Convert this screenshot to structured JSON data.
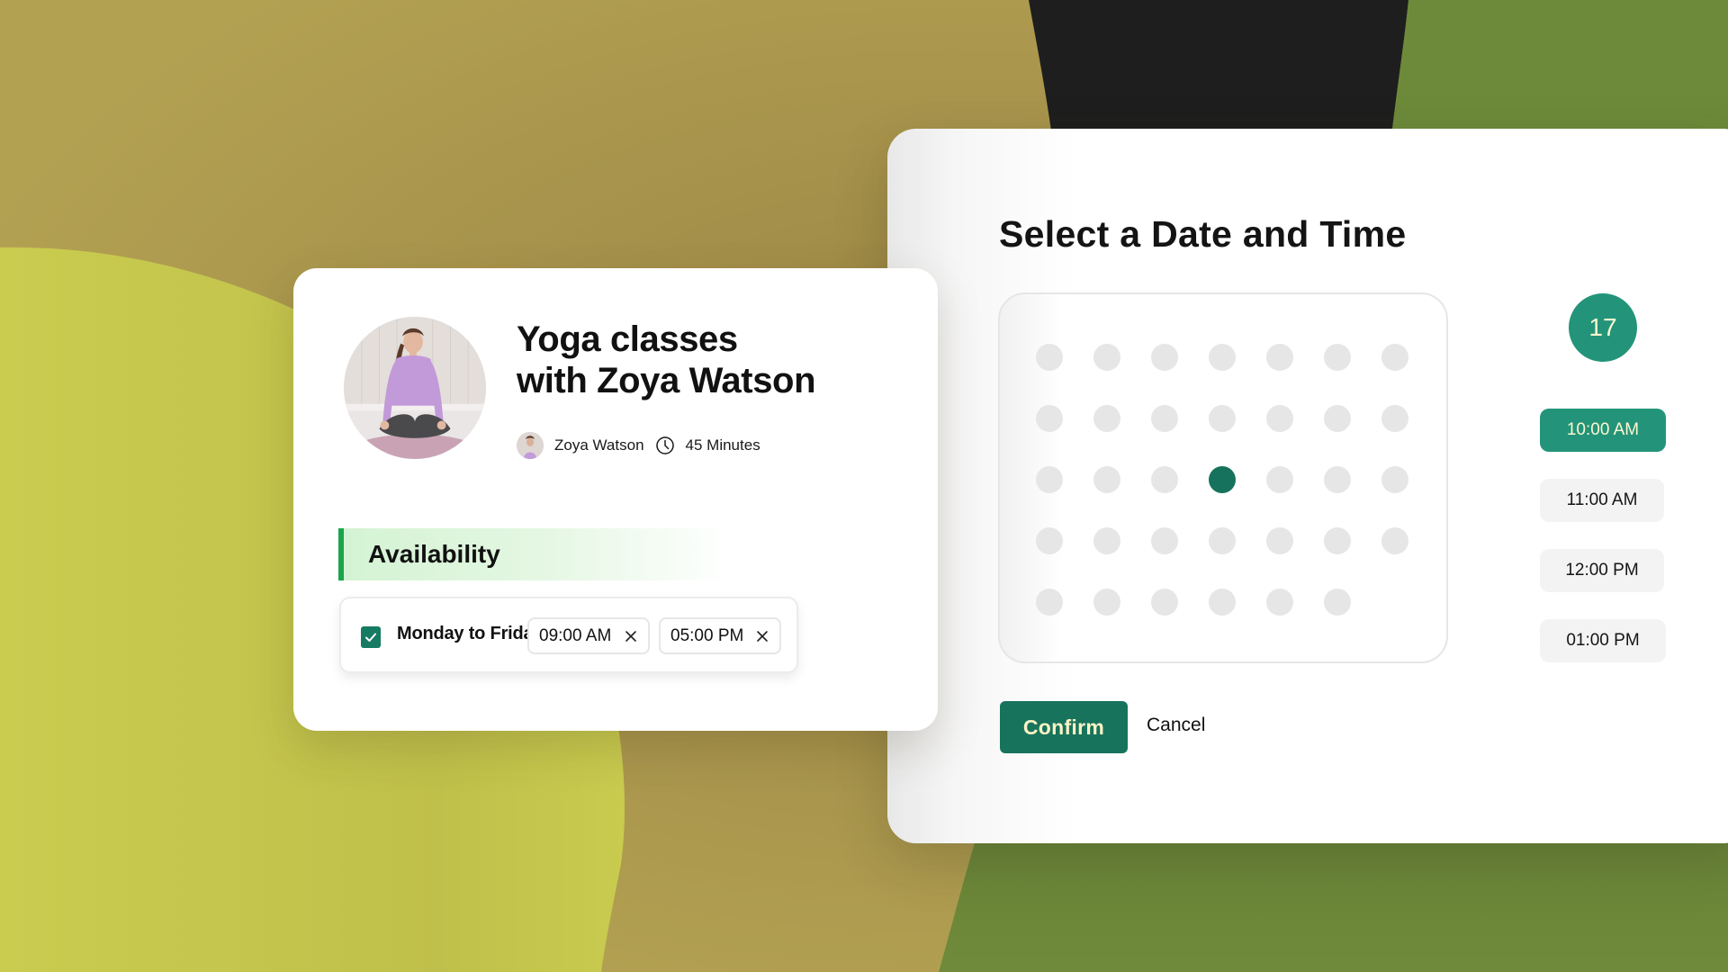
{
  "colors": {
    "background_olive": "#b09e50",
    "background_lime": "#c8cb4e",
    "background_dark": "#1e1e1e",
    "background_green": "#6d8a3a",
    "accent_green": "#23947a",
    "button_green": "#18735c",
    "availability_bar": "#1aa54a",
    "button_text": "#fbf3c6"
  },
  "class_card": {
    "photo": "yoga-instructor-photo",
    "title_line1": "Yoga classes",
    "title_line2": "with Zoya Watson",
    "instructor_name": "Zoya Watson",
    "duration": "45 Minutes",
    "availability": {
      "heading": "Availability",
      "days_label": "Monday to Friday",
      "days_checked": true,
      "start_time": "09:00 AM",
      "end_time": "05:00 PM"
    }
  },
  "date_picker": {
    "title": "Select a Date and Time",
    "calendar": {
      "rows": [
        7,
        7,
        7,
        7,
        6
      ],
      "selected_row": 3,
      "selected_col": 4
    },
    "selected_date": "17",
    "time_slots": [
      {
        "label": "10:00 AM",
        "selected": true
      },
      {
        "label": "11:00 AM",
        "selected": false
      },
      {
        "label": "12:00 PM",
        "selected": false
      },
      {
        "label": "01:00 PM",
        "selected": false
      }
    ],
    "confirm_label": "Confirm",
    "cancel_label": "Cancel"
  }
}
